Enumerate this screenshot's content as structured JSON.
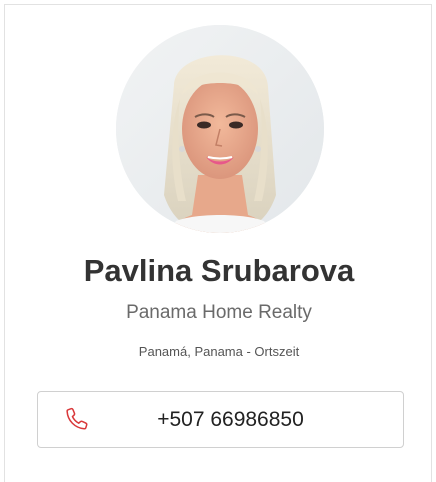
{
  "agent": {
    "name": "Pavlina Srubarova",
    "company": "Panama Home Realty",
    "timezone": "Panamá, Panama - Ortszeit",
    "phone": "+507 66986850"
  },
  "colors": {
    "phone_icon": "#d9383a",
    "name_text": "#333333",
    "company_text": "#6a6a6a"
  },
  "icons": {
    "phone": "phone-icon"
  }
}
